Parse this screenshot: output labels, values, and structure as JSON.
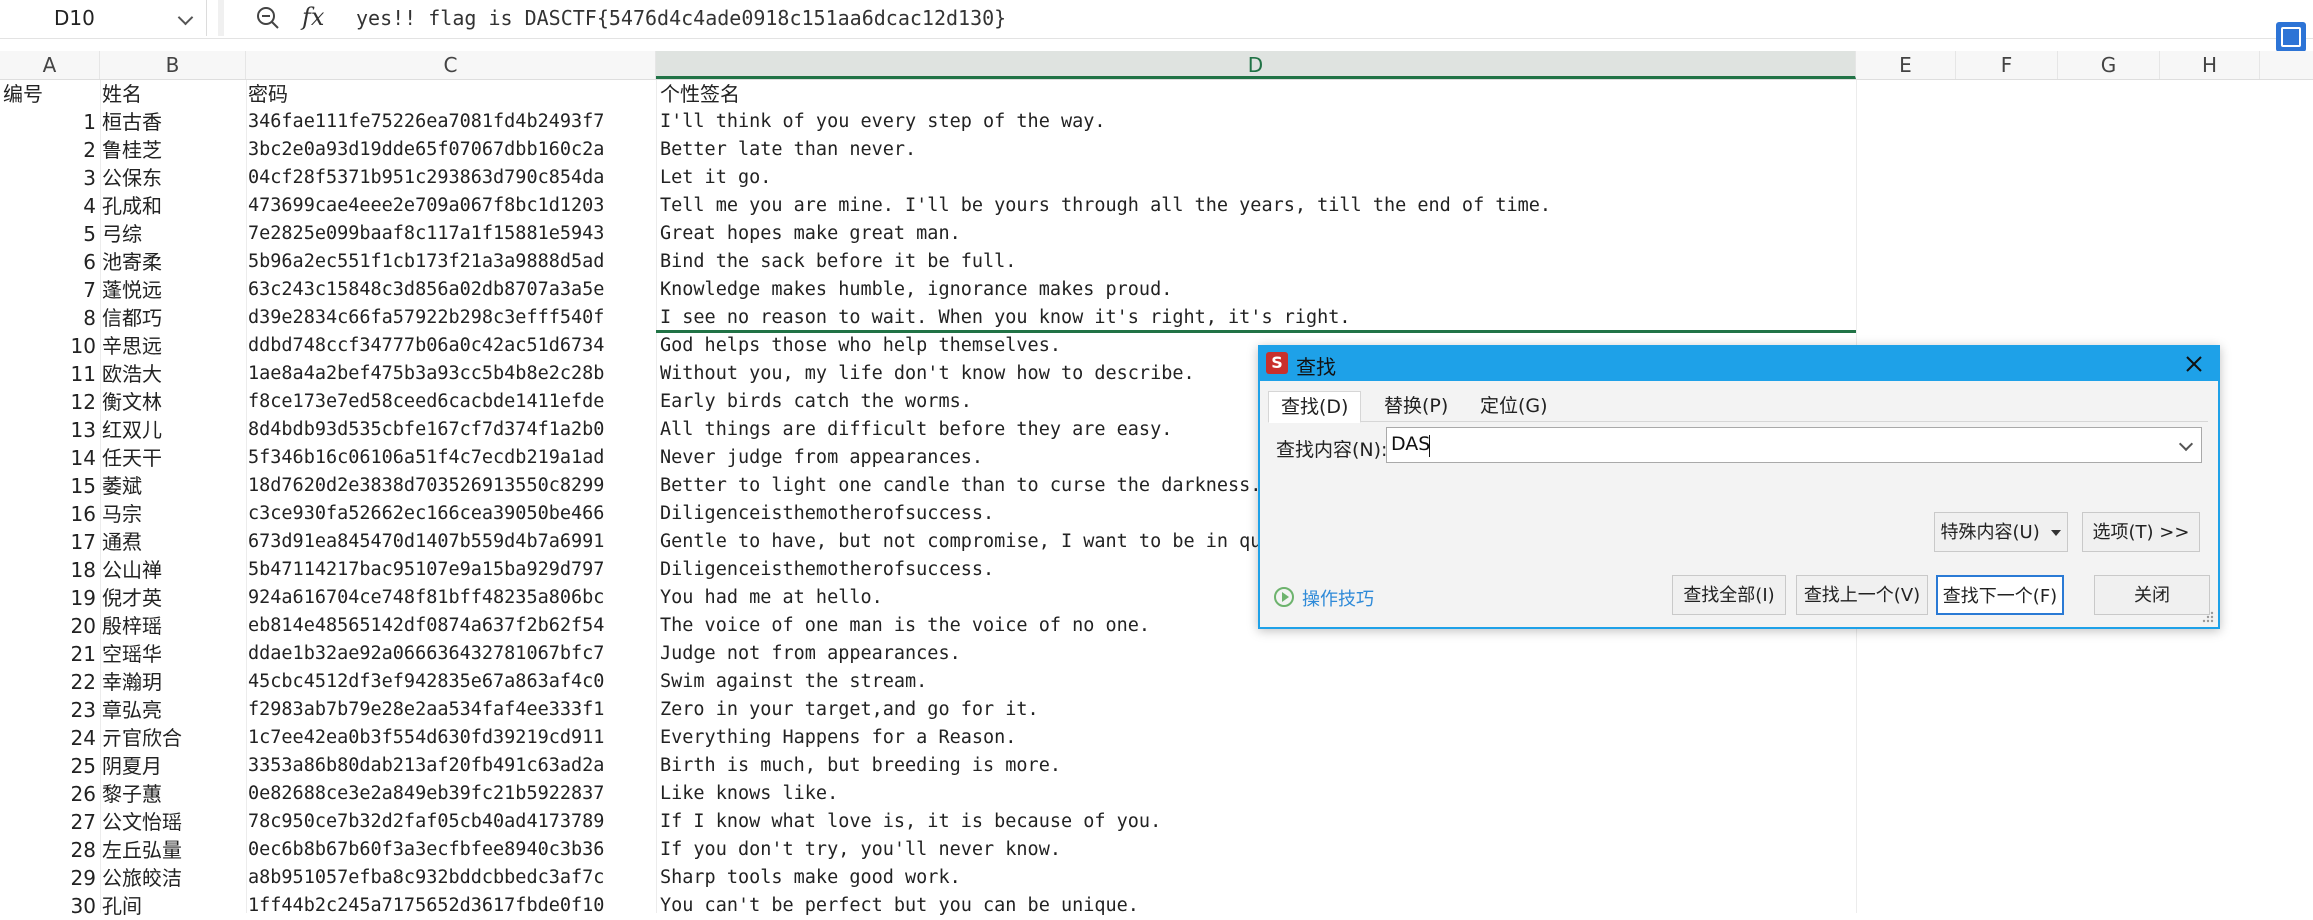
{
  "formula_bar": {
    "cell_ref": "D10",
    "fx": "fx",
    "content": "yes!! flag is DASCTF{5476d4c4ade0918c151aa6dcac12d130}"
  },
  "columns": [
    "A",
    "B",
    "C",
    "D",
    "E",
    "F",
    "G",
    "H"
  ],
  "header_row": {
    "a": "编号",
    "b": "姓名",
    "c": "密码",
    "d": "个性签名"
  },
  "rows": [
    {
      "n": "1",
      "name": "桓古香",
      "pwd": "346fae111fe75226ea7081fd4b2493f7",
      "sig": "I'll think of you every step of the way."
    },
    {
      "n": "2",
      "name": "鲁桂芝",
      "pwd": "3bc2e0a93d19dde65f07067dbb160c2a",
      "sig": "Better late than never."
    },
    {
      "n": "3",
      "name": "公保东",
      "pwd": "04cf28f5371b951c293863d790c854da",
      "sig": "Let it go."
    },
    {
      "n": "4",
      "name": "孔成和",
      "pwd": "473699cae4eee2e709a067f8bc1d1203",
      "sig": "Tell me you are mine. I'll be yours through all the years, till the end of time."
    },
    {
      "n": "5",
      "name": "弓综",
      "pwd": "7e2825e099baaf8c117a1f15881e5943",
      "sig": "Great hopes make great man."
    },
    {
      "n": "6",
      "name": "池寄柔",
      "pwd": "5b96a2ec551f1cb173f21a3a9888d5ad",
      "sig": "Bind the sack before it be full."
    },
    {
      "n": "7",
      "name": "蓬悦远",
      "pwd": "63c243c15848c3d856a02db8707a3a5e",
      "sig": "Knowledge makes humble, ignorance makes proud."
    },
    {
      "n": "8",
      "name": "信都巧",
      "pwd": "d39e2834c66fa57922b298c3efff540f",
      "sig": "I see no reason to wait. When you know it's right, it's right."
    },
    {
      "n": "10",
      "name": "辛思远",
      "pwd": "ddbd748ccf34777b06a0c42ac51d6734",
      "sig": "God helps those who help themselves."
    },
    {
      "n": "11",
      "name": "欧浩大",
      "pwd": "1ae8a4a2bef475b3a93cc5b4b8e2c28b",
      "sig": "Without you, my life don't know how to describe."
    },
    {
      "n": "12",
      "name": "衡文林",
      "pwd": "f8ce173e7ed58ceed6cacbde1411efde",
      "sig": "Early birds catch the worms."
    },
    {
      "n": "13",
      "name": "红双儿",
      "pwd": "8d4bdb93d535cbfe167cf7d374f1a2b0",
      "sig": "All things are difficult before they are easy."
    },
    {
      "n": "14",
      "name": "任天干",
      "pwd": "5f346b16c06106a51f4c7ecdb219a1ad",
      "sig": "Never judge from appearances."
    },
    {
      "n": "15",
      "name": "萎斌",
      "pwd": "18d7620d2e3838d703526913550c8299",
      "sig": "Better to light one candle than to curse the darkness."
    },
    {
      "n": "16",
      "name": "马宗",
      "pwd": "c3ce930fa52662ec166cea39050be466",
      "sig": "Diligenceisthemotherofsuccess."
    },
    {
      "n": "17",
      "name": "通焄",
      "pwd": "673d91ea845470d1407b559d4b7a6991",
      "sig": "Gentle to have, but not compromise, I want to be in qu"
    },
    {
      "n": "18",
      "name": "公山禅",
      "pwd": "5b47114217bac95107e9a15ba929d797",
      "sig": "Diligenceisthemotherofsuccess."
    },
    {
      "n": "19",
      "name": "倪才英",
      "pwd": "924a616704ce748f81bff48235a806bc",
      "sig": "You had me at hello."
    },
    {
      "n": "20",
      "name": "殷梓瑶",
      "pwd": "eb814e48565142df0874a637f2b62f54",
      "sig": "The voice of one man is the voice of no one."
    },
    {
      "n": "21",
      "name": "空瑶华",
      "pwd": "ddae1b32ae92a066636432781067bfc7",
      "sig": "Judge not from appearances."
    },
    {
      "n": "22",
      "name": "幸瀚玥",
      "pwd": "45cbc4512df3ef942835e67a863af4c0",
      "sig": "Swim against the stream."
    },
    {
      "n": "23",
      "name": "章弘亮",
      "pwd": "f2983ab7b79e28e2aa534faf4ee333f1",
      "sig": "Zero in your target,and go for it."
    },
    {
      "n": "24",
      "name": "亓官欣合",
      "pwd": "1c7ee42ea0b3f554d630fd39219cd911",
      "sig": "Everything Happens for a Reason."
    },
    {
      "n": "25",
      "name": "阴夏月",
      "pwd": "3353a86b80dab213af20fb491c63ad2a",
      "sig": "Birth is much, but breeding is more."
    },
    {
      "n": "26",
      "name": "黎子蕙",
      "pwd": "0e82688ce3e2a849eb39fc21b5922837",
      "sig": "Like knows like."
    },
    {
      "n": "27",
      "name": "公文怡瑶",
      "pwd": "78c950ce7b32d2faf05cb40ad4173789",
      "sig": "If I know what love is, it is because of you."
    },
    {
      "n": "28",
      "name": "左丘弘量",
      "pwd": "0ec6b8b67b60f3a3ecfbfee8940c3b36",
      "sig": "If you don't try, you'll never know."
    },
    {
      "n": "29",
      "name": "公旅皎洁",
      "pwd": "a8b951057efba8c932bddcbbedc3af7c",
      "sig": "Sharp tools make good work."
    },
    {
      "n": "30",
      "name": "孔间",
      "pwd": "1ff44b2c245a7175652d3617fbde0f10",
      "sig": "You can't be perfect but you can be unique."
    }
  ],
  "dialog": {
    "logo": "S",
    "title": "查找",
    "tabs": [
      {
        "label": "查找(D)",
        "active": true
      },
      {
        "label": "替换(P)",
        "active": false
      },
      {
        "label": "定位(G)",
        "active": false
      }
    ],
    "find_label": "查找内容(N):",
    "find_value": "DAS",
    "special_button": "特殊内容(U)",
    "options_button": "选项(T) >>",
    "tips_link": "操作技巧",
    "find_all": "查找全部(I)",
    "find_prev": "查找上一个(V)",
    "find_next": "查找下一个(F)",
    "close": "关闭"
  },
  "colors": {
    "accent_green": "#217346",
    "dialog_blue": "#1ea1e8",
    "link_blue": "#2e8ad8"
  }
}
